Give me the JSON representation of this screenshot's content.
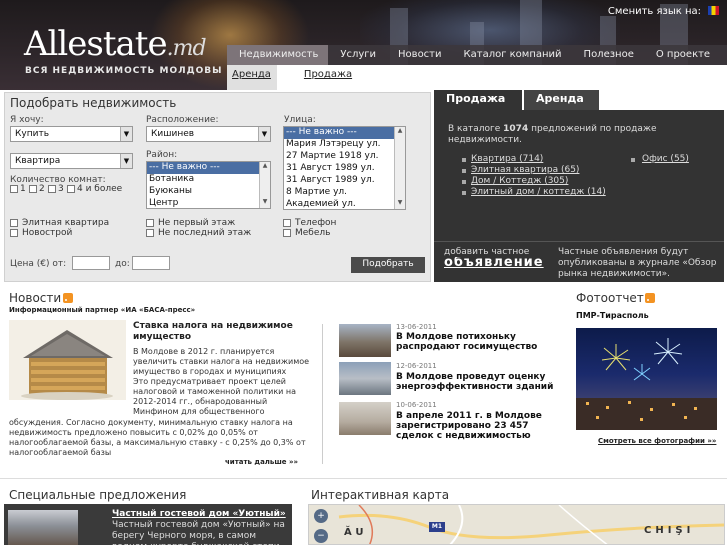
{
  "header": {
    "logo_main": "Allestate",
    "logo_tld": ".md",
    "tagline": "ВСЯ НЕДВИЖИМОСТЬ МОЛДОВЫ",
    "language_label": "Сменить язык на:",
    "nav": [
      "Недвижимость",
      "Услуги",
      "Новости",
      "Каталог компаний",
      "Полезное",
      "О проекте"
    ],
    "subnav": [
      "Аренда",
      "Продажа"
    ]
  },
  "search": {
    "title": "Подобрать недвижимость",
    "want_label": "Я хочу:",
    "want_value": "Купить",
    "type_value": "Квартира",
    "rooms_label": "Количество комнат:",
    "rooms": [
      "1",
      "2",
      "3",
      "4 и более"
    ],
    "location_label": "Расположение:",
    "location_value": "Кишинев",
    "district_label": "Район:",
    "districts": [
      "--- Не важно ---",
      "Ботаника",
      "Буюканы",
      "Центр"
    ],
    "street_label": "Улица:",
    "streets": [
      "--- Не важно ---",
      "Мария Лэтэрецу ул.",
      "27 Мартие 1918 ул.",
      "31 Август 1989 ул.",
      "31 Август 1989 ул.",
      "8 Мартие ул.",
      "Академией ул."
    ],
    "checkboxes": [
      "Элитная квартира",
      "Новострой",
      "Не первый этаж",
      "Не последний этаж",
      "Телефон",
      "Мебель"
    ],
    "price_label": "Цена (€) от:",
    "price_to_label": "до:",
    "submit": "Подобрать"
  },
  "sale": {
    "tab_sale": "Продажа",
    "tab_rent": "Аренда",
    "catalog_pre": "В каталоге",
    "catalog_count": "1074",
    "catalog_post": "предложений по продаже недвижимости.",
    "links_left": [
      "Квартира (714)",
      "Элитная квартира (65)",
      "Дом / Коттедж (305)",
      "Элитный дом / коттедж (14)"
    ],
    "links_right": [
      "Офис (55)"
    ],
    "add_private_label": "добавить частное",
    "add_private_big": "объявление",
    "private_note": "Частные объявления будут опубликованы в журнале «Обзор рынка недвижимости»."
  },
  "news": {
    "title": "Новости",
    "partner": "Информационный партнер «ИА «БАСА-пресс»",
    "main_title": "Ставка налога на недвижимое имущество",
    "main_text_top": "В Молдове в 2012 г. планируется увеличить ставки налога на недвижимое имущество в городах и муниципиях",
    "main_text_mid": "Это предусматривает проект целей налоговой и таможенной политики на 2012-2014 гг., обнародованный Минфином для общественного",
    "main_text_bottom": "обсуждения. Согласно документу, минимальную ставку налога на недвижимость предложено повысить с 0,02% до 0,05% от налогооблагаемой базы, а максимальную ставку - с 0,25% до 0,3% от налогооблагаемой базы",
    "read_more": "читать дальше »»",
    "items": [
      {
        "date": "13-06-2011",
        "title": "В Молдове потихоньку распродают госимущество"
      },
      {
        "date": "12-06-2011",
        "title": "В Молдове проведут оценку энергоэффективности зданий"
      },
      {
        "date": "10-06-2011",
        "title": "В апреле 2011 г. в Молдове зарегистрировано 23 457 сделок с недвижимостью"
      }
    ]
  },
  "photo": {
    "title": "Фотоотчет",
    "caption": "ПМР-Тирасполь",
    "all_link": "Смотреть все фотографии »»"
  },
  "special": {
    "title": "Специальные предложения",
    "head": "Частный гостевой дом «Уютный»",
    "text": "Частный гостевой дом «Уютный» на берегу Черного моря, в самом водном курорте буджакской степи"
  },
  "map": {
    "title": "Интерактивная карта",
    "zoom_in": "+",
    "zoom_out": "−",
    "label_left": "ĂU",
    "label_right": "CHIŞI",
    "road_sign": "M1"
  },
  "colors": {
    "header_dark": "#2b2428",
    "panel_dark": "#333333",
    "search_bg": "#e9e9e9",
    "rss_orange": "#f39322",
    "listbox_highlight": "#4a6ea3"
  }
}
